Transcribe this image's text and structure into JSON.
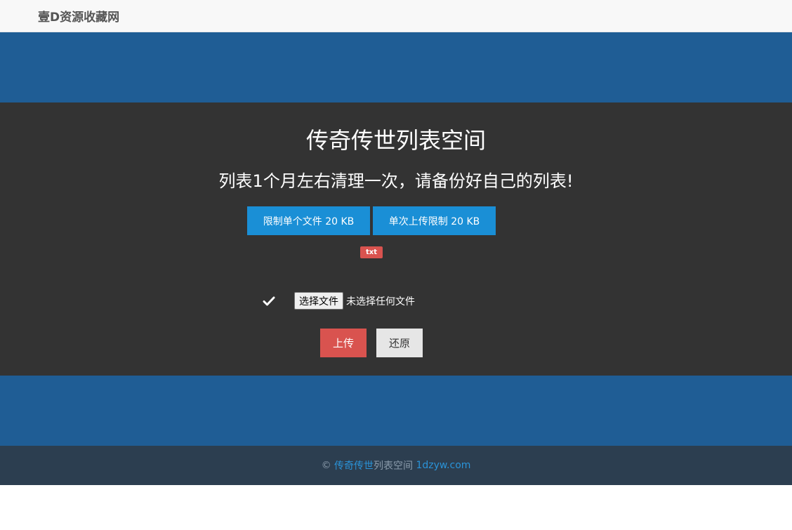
{
  "navbar": {
    "brand": "壹D资源收藏网"
  },
  "panel": {
    "title": "传奇传世列表空间",
    "notice": "列表1个月左右清理一次，请备份好自己的列表!",
    "limits": [
      "限制单个文件 20 KB",
      "单次上传限制 20 KB"
    ],
    "badge": "txt",
    "file_button": "选择文件",
    "file_status": "未选择任何文件",
    "upload_label": "上传",
    "reset_label": "还原"
  },
  "footer": {
    "copyright": "©",
    "site_link": "传奇传世",
    "site_suffix": "列表空间",
    "domain_link": "1dzyw.com"
  },
  "colors": {
    "band_blue": "#1f5d95",
    "panel_dark": "#333333",
    "limit_blue": "#1a8fd6",
    "danger_red": "#d9534f",
    "footer_navy": "#2c3e50"
  },
  "icons": {
    "check": "check-icon"
  }
}
